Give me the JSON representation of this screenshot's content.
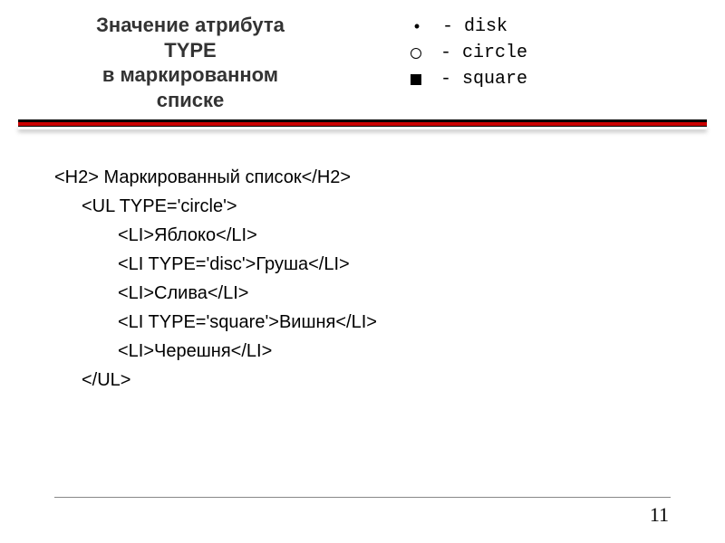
{
  "title": {
    "line1": "Значение атрибута",
    "line2": "TYPE",
    "line3": "в маркированном",
    "line4": "списке"
  },
  "legend": [
    {
      "marker": "disc",
      "label": "- disk"
    },
    {
      "marker": "circle",
      "label": "- circle"
    },
    {
      "marker": "square",
      "label": "- square"
    }
  ],
  "code": {
    "l0": "<H2> Маркированный список</H2>",
    "l1": "<UL TYPE='circle'>",
    "l2": "<LI>Яблоко</LI>",
    "l3": "<LI TYPE='disc'>Груша</LI>",
    "l4": "<LI>Слива</LI>",
    "l5": "<LI TYPE='square'>Вишня</LI>",
    "l6": "<LI>Черешня</LI>",
    "l7": "</UL>"
  },
  "page_number": "11"
}
